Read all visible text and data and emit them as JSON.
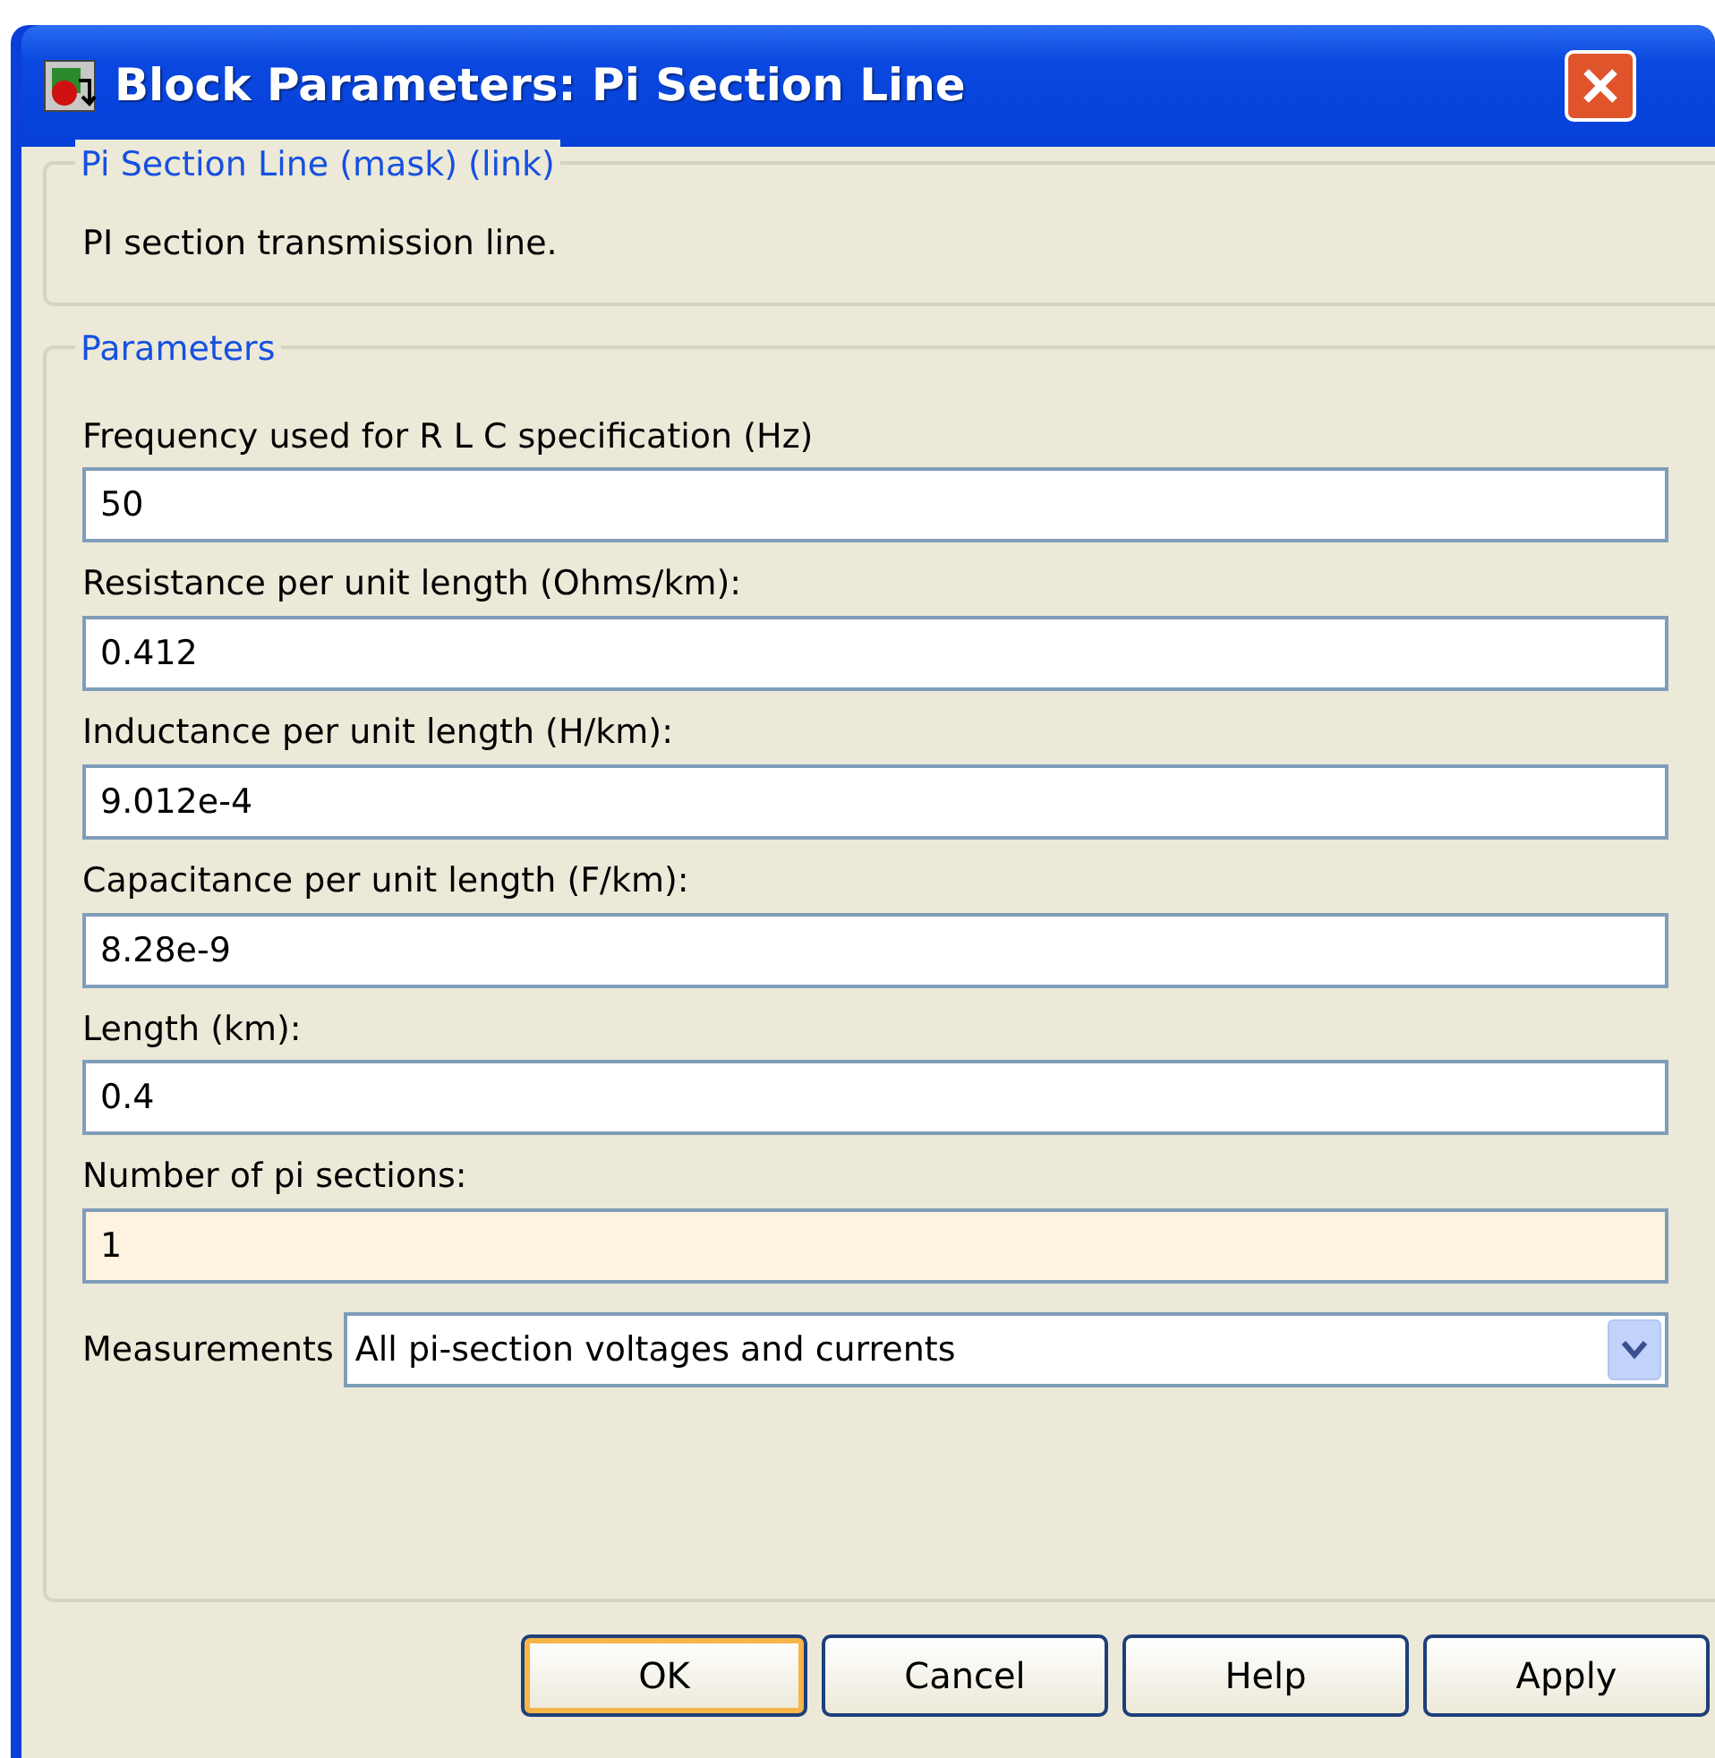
{
  "window": {
    "title": "Block Parameters: Pi Section Line"
  },
  "description_group": {
    "legend": "Pi Section Line (mask) (link)",
    "text": "PI section transmission line."
  },
  "parameters_group": {
    "legend": "Parameters",
    "fields": [
      {
        "label": "Frequency used for R L C specification (Hz)",
        "value": "50",
        "focused": false
      },
      {
        "label": "Resistance per unit length (Ohms/km):",
        "value": "0.412",
        "focused": false
      },
      {
        "label": "Inductance per unit length (H/km):",
        "value": "9.012e-4",
        "focused": false
      },
      {
        "label": "Capacitance per unit length (F/km):",
        "value": "8.28e-9",
        "focused": false
      },
      {
        "label": "Length (km):",
        "value": "0.4",
        "focused": false
      },
      {
        "label": "Number of pi sections:",
        "value": "1",
        "focused": true
      }
    ],
    "measurements": {
      "label": "Measurements",
      "value": "All pi-section voltages and currents"
    }
  },
  "buttons": [
    {
      "label": "OK",
      "default": true
    },
    {
      "label": "Cancel",
      "default": false
    },
    {
      "label": "Help",
      "default": false
    },
    {
      "label": "Apply",
      "default": false
    }
  ]
}
